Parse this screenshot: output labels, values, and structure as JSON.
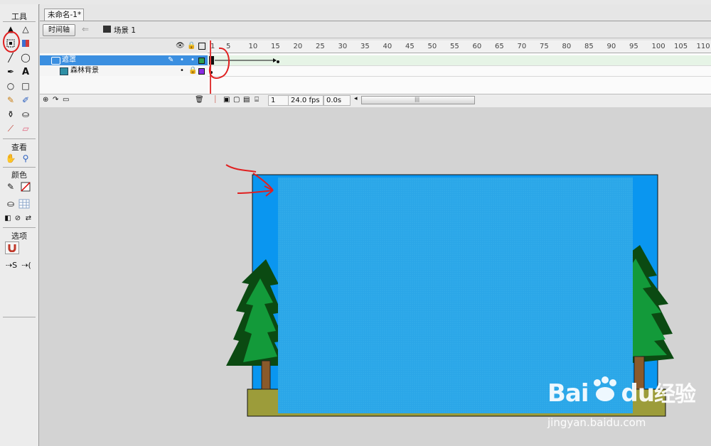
{
  "document": {
    "tab_title": "未命名-1*"
  },
  "editbar": {
    "timeline_button": "时间轴",
    "scene_label": "场景 1"
  },
  "tools_panel": {
    "title": "工具",
    "view_title": "查看",
    "colors_title": "颜色",
    "options_title": "选项"
  },
  "timeline": {
    "frame_ticks": [
      "1",
      "5",
      "10",
      "15",
      "20",
      "25",
      "30",
      "35",
      "40",
      "45",
      "50",
      "55",
      "60",
      "65",
      "70",
      "75",
      "80",
      "85",
      "90",
      "95",
      "100",
      "105",
      "110"
    ],
    "layers": [
      {
        "name": "遮罩",
        "type": "mask",
        "selected": true
      },
      {
        "name": "森林背景",
        "type": "masked",
        "selected": false
      }
    ],
    "current_frame": "1",
    "fps": "24.0 fps",
    "elapsed": "0.0s"
  },
  "stage": {
    "sky_color": "#0a96f0",
    "mask_color": "#2aa6e8",
    "tree_dark": "#0b4a12",
    "tree_light": "#139a3a",
    "ground_color": "#9c9c3a"
  },
  "watermark": {
    "logo_bai": "Bai",
    "logo_du": "du",
    "logo_jingyan": "经验",
    "url": "jingyan.baidu.com"
  }
}
